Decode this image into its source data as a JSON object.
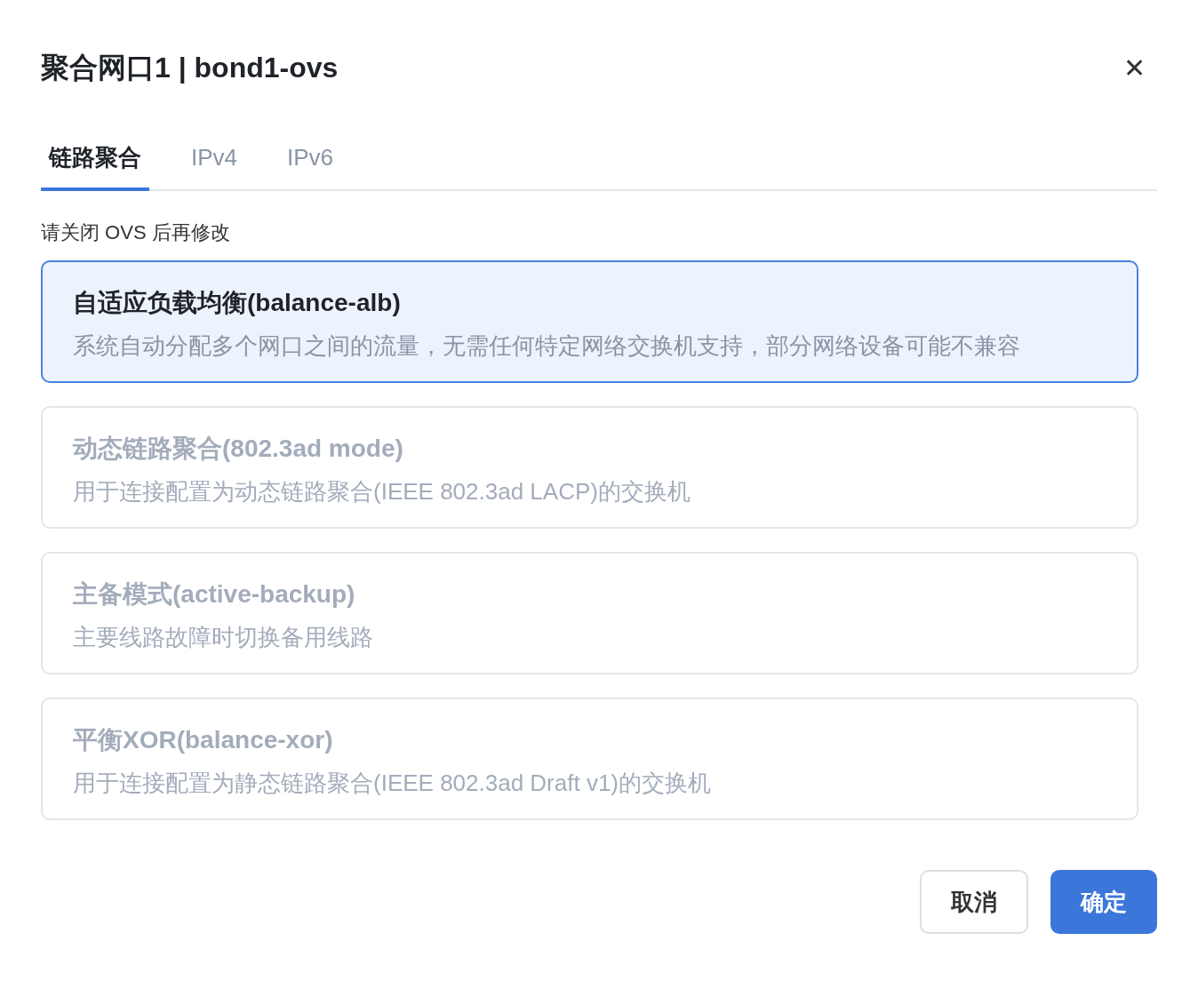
{
  "dialog": {
    "title": "聚合网口1 | bond1-ovs",
    "close": "✕"
  },
  "tabs": [
    {
      "label": "链路聚合",
      "selected": true
    },
    {
      "label": "IPv4",
      "selected": false
    },
    {
      "label": "IPv6",
      "selected": false
    }
  ],
  "notice": "请关闭 OVS 后再修改",
  "options": [
    {
      "title": "自适应负载均衡(balance-alb)",
      "description": "系统自动分配多个网口之间的流量，无需任何特定网络交换机支持，部分网络设备可能不兼容",
      "selected": true,
      "disabled": false
    },
    {
      "title": "动态链路聚合(802.3ad mode)",
      "description": "用于连接配置为动态链路聚合(IEEE 802.3ad LACP)的交换机",
      "selected": false,
      "disabled": true
    },
    {
      "title": "主备模式(active-backup)",
      "description": "主要线路故障时切换备用线路",
      "selected": false,
      "disabled": true
    },
    {
      "title": "平衡XOR(balance-xor)",
      "description": "用于连接配置为静态链路聚合(IEEE 802.3ad Draft v1)的交换机",
      "selected": false,
      "disabled": true
    }
  ],
  "buttons": [
    {
      "label": "取消",
      "kind": "secondary"
    },
    {
      "label": "确定",
      "kind": "primary"
    }
  ]
}
